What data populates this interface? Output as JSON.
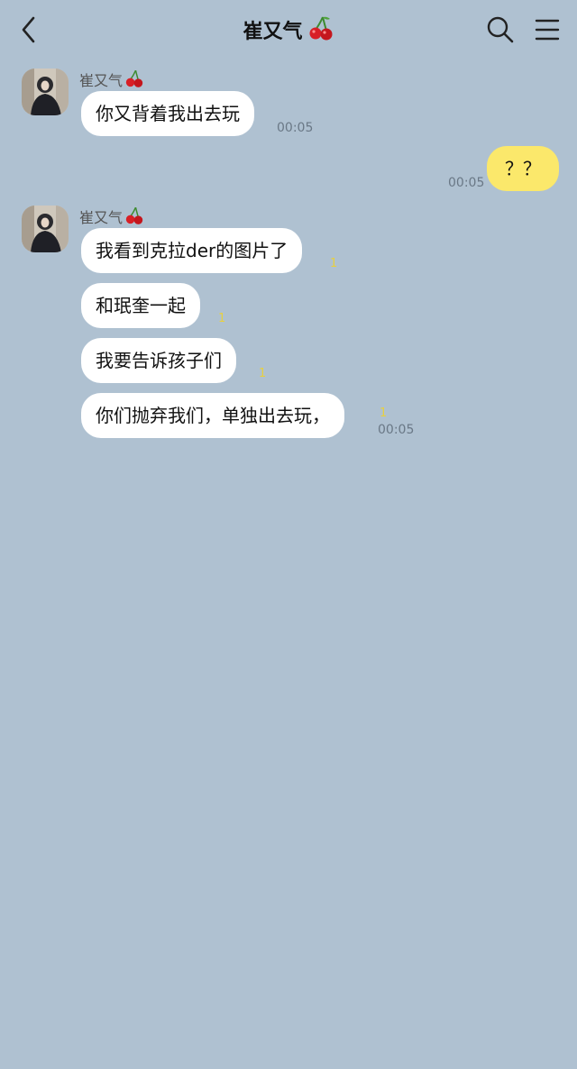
{
  "header": {
    "title": "崔又气",
    "title_emoji": "cherry-icon"
  },
  "contact": {
    "name": "崔又气"
  },
  "messages": [
    {
      "text": "你又背着我出去玩",
      "time": "00:05",
      "unread": ""
    },
    {
      "text": "？？",
      "time": "00:05",
      "unread": ""
    },
    {
      "text": "我看到克拉der的图片了",
      "time": "",
      "unread": "1"
    },
    {
      "text": "和珉奎一起",
      "time": "",
      "unread": "1"
    },
    {
      "text": "我要告诉孩子们",
      "time": "",
      "unread": "1"
    },
    {
      "text": "你们抛弃我们，单独出去玩，",
      "time": "00:05",
      "unread": "1"
    }
  ],
  "colors": {
    "background": "#afc1d1",
    "incoming_bubble": "#ffffff",
    "outgoing_bubble": "#fbe86b",
    "unread": "#e8d040"
  }
}
